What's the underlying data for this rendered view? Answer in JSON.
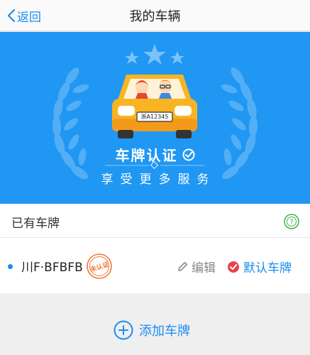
{
  "nav": {
    "back_label": "返回",
    "title": "我的车辆"
  },
  "banner": {
    "plate_on_car": "浙A12345",
    "title": "车牌认证",
    "subtitle": "享受更多服务"
  },
  "section": {
    "label": "已有车牌"
  },
  "plate": {
    "number": "川F·BFBFB",
    "status_stamp": "未认证",
    "edit_label": "编辑",
    "default_label": "默认车牌"
  },
  "add": {
    "label": "添加车牌"
  },
  "colors": {
    "accent": "#1b8cf2",
    "banner": "#1f97f3",
    "car": "#f8b423",
    "stamp": "#f07a3a"
  }
}
